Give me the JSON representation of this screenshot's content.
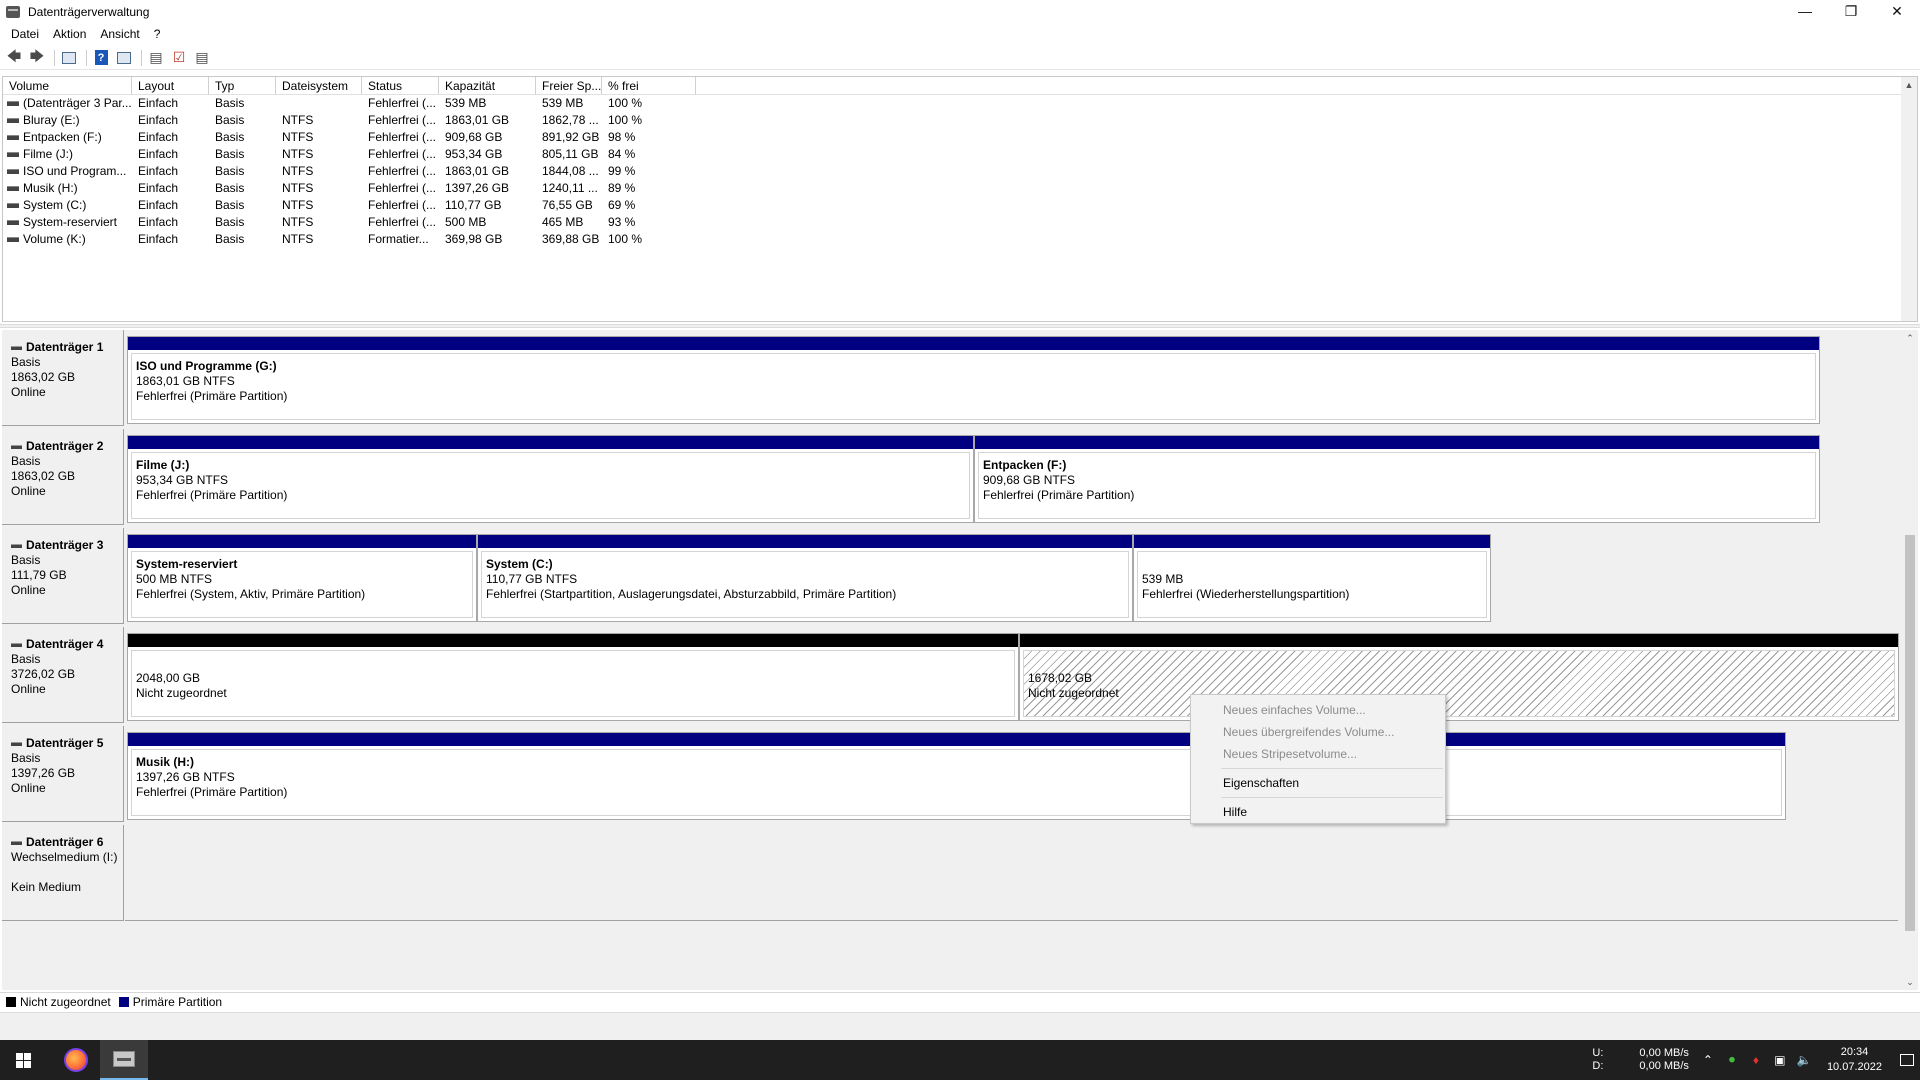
{
  "window": {
    "title": "Datenträgerverwaltung"
  },
  "menu": [
    "Datei",
    "Aktion",
    "Ansicht",
    "?"
  ],
  "toolbar_icons": [
    "back-arrow-icon",
    "forward-arrow-icon",
    "console-tree-icon",
    "help-icon",
    "properties-icon",
    "disk-icon",
    "checkmark-icon",
    "list-view-icon"
  ],
  "volumes": {
    "headers": [
      "Volume",
      "Layout",
      "Typ",
      "Dateisystem",
      "Status",
      "Kapazität",
      "Freier Sp...",
      "% frei"
    ],
    "rows": [
      [
        "(Datenträger 3 Par...",
        "Einfach",
        "Basis",
        "",
        "Fehlerfrei (...",
        "539 MB",
        "539 MB",
        "100 %"
      ],
      [
        "Bluray  (E:)",
        "Einfach",
        "Basis",
        "NTFS",
        "Fehlerfrei (...",
        "1863,01 GB",
        "1862,78 ...",
        "100 %"
      ],
      [
        "Entpacken (F:)",
        "Einfach",
        "Basis",
        "NTFS",
        "Fehlerfrei (...",
        "909,68 GB",
        "891,92 GB",
        "98 %"
      ],
      [
        "Filme (J:)",
        "Einfach",
        "Basis",
        "NTFS",
        "Fehlerfrei (...",
        "953,34 GB",
        "805,11 GB",
        "84 %"
      ],
      [
        "ISO und Program...",
        "Einfach",
        "Basis",
        "NTFS",
        "Fehlerfrei (...",
        "1863,01 GB",
        "1844,08 ...",
        "99 %"
      ],
      [
        "Musik (H:)",
        "Einfach",
        "Basis",
        "NTFS",
        "Fehlerfrei (...",
        "1397,26 GB",
        "1240,11 ...",
        "89 %"
      ],
      [
        "System (C:)",
        "Einfach",
        "Basis",
        "NTFS",
        "Fehlerfrei (...",
        "110,77 GB",
        "76,55 GB",
        "69 %"
      ],
      [
        "System-reserviert",
        "Einfach",
        "Basis",
        "NTFS",
        "Fehlerfrei (...",
        "500 MB",
        "465 MB",
        "93 %"
      ],
      [
        "Volume (K:)",
        "Einfach",
        "Basis",
        "NTFS",
        "Formatier...",
        "369,98 GB",
        "369,88 GB",
        "100 %"
      ]
    ]
  },
  "disks": [
    {
      "name": "Datenträger 1",
      "type": "Basis",
      "size": "1863,02 GB",
      "status": "Online",
      "partitions": [
        {
          "name": "ISO und Programme  (G:)",
          "size": "1863,01 GB NTFS",
          "status": "Fehlerfrei (Primäre Partition)"
        }
      ]
    },
    {
      "name": "Datenträger 2",
      "type": "Basis",
      "size": "1863,02 GB",
      "status": "Online",
      "partitions": [
        {
          "name": "Filme  (J:)",
          "size": "953,34 GB NTFS",
          "status": "Fehlerfrei (Primäre Partition)"
        },
        {
          "name": "Entpacken  (F:)",
          "size": "909,68 GB NTFS",
          "status": "Fehlerfrei (Primäre Partition)"
        }
      ]
    },
    {
      "name": "Datenträger 3",
      "type": "Basis",
      "size": "111,79 GB",
      "status": "Online",
      "partitions": [
        {
          "name": "System-reserviert",
          "size": "500 MB NTFS",
          "status": "Fehlerfrei (System, Aktiv, Primäre Partition)"
        },
        {
          "name": "System  (C:)",
          "size": "110,77 GB NTFS",
          "status": "Fehlerfrei (Startpartition, Auslagerungsdatei, Absturzabbild, Primäre Partition)"
        },
        {
          "name": "",
          "size": "539 MB",
          "status": "Fehlerfrei (Wiederherstellungspartition)"
        }
      ]
    },
    {
      "name": "Datenträger 4",
      "type": "Basis",
      "size": "3726,02 GB",
      "status": "Online",
      "partitions": [
        {
          "name": "",
          "size": "2048,00 GB",
          "status": "Nicht zugeordnet"
        },
        {
          "name": "",
          "size": "1678,02 GB",
          "status": "Nicht zugeordnet"
        }
      ]
    },
    {
      "name": "Datenträger 5",
      "type": "Basis",
      "size": "1397,26 GB",
      "status": "Online",
      "partitions": [
        {
          "name": "Musik  (H:)",
          "size": "1397,26 GB NTFS",
          "status": "Fehlerfrei (Primäre Partition)"
        }
      ]
    },
    {
      "name": "Datenträger 6",
      "type": "Wechselmedium (I:)",
      "size": "",
      "status": "Kein Medium",
      "partitions": []
    }
  ],
  "legend": [
    {
      "label": "Nicht zugeordnet",
      "color": "#000000"
    },
    {
      "label": "Primäre Partition",
      "color": "#000080"
    }
  ],
  "context_menu": [
    {
      "label": "Neues einfaches Volume...",
      "enabled": false
    },
    {
      "label": "Neues übergreifendes Volume...",
      "enabled": false
    },
    {
      "label": "Neues Stripesetvolume...",
      "enabled": false
    },
    {
      "label": "Eigenschaften",
      "enabled": true
    },
    {
      "label": "Hilfe",
      "enabled": true
    }
  ],
  "taskbar": {
    "net_labels": [
      "U:",
      "D:"
    ],
    "net_values": [
      "0,00 MB/s",
      "0,00 MB/s"
    ],
    "time": "20:34",
    "date": "10.07.2022"
  },
  "colors": {
    "primary_partition": "#000080",
    "unallocated": "#000000",
    "taskbar": "#1f1f1f"
  }
}
